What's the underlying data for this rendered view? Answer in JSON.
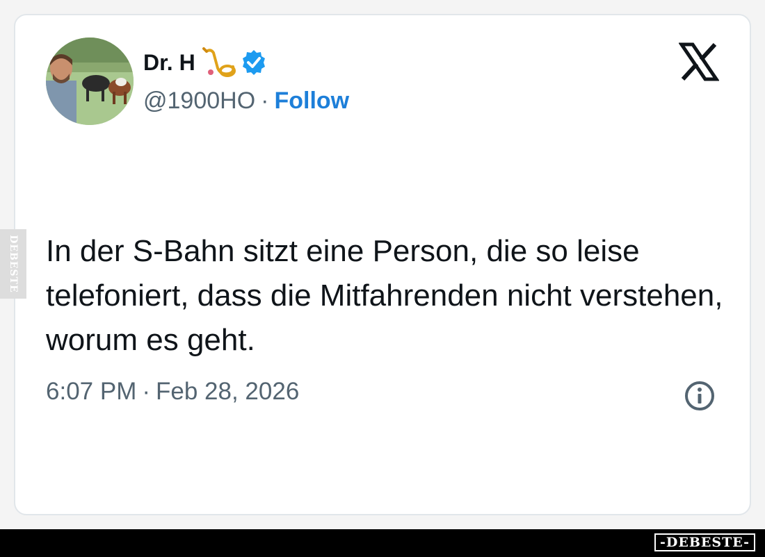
{
  "tweet": {
    "author_name": "Dr. H",
    "handle": "@1900HO",
    "separator": "·",
    "follow_label": "Follow",
    "text": "In der S-Bahn sitzt eine Person, die so leise telefoniert, dass die Mitfahrenden nicht verstehen, worum es geht.",
    "time": "6:07 PM",
    "date": "Feb 28, 2026",
    "icons": {
      "name_emoji": "postal-horn-icon",
      "verified": "verified-badge-icon",
      "brand": "x-logo-icon",
      "info": "info-icon"
    }
  },
  "watermark": {
    "side_label": "DEBESTE",
    "bottom_label": "-DEBESTE-"
  },
  "colors": {
    "link": "#1d7fd9",
    "verified": "#1d9bf0",
    "text": "#0f1419",
    "muted": "#536471"
  }
}
